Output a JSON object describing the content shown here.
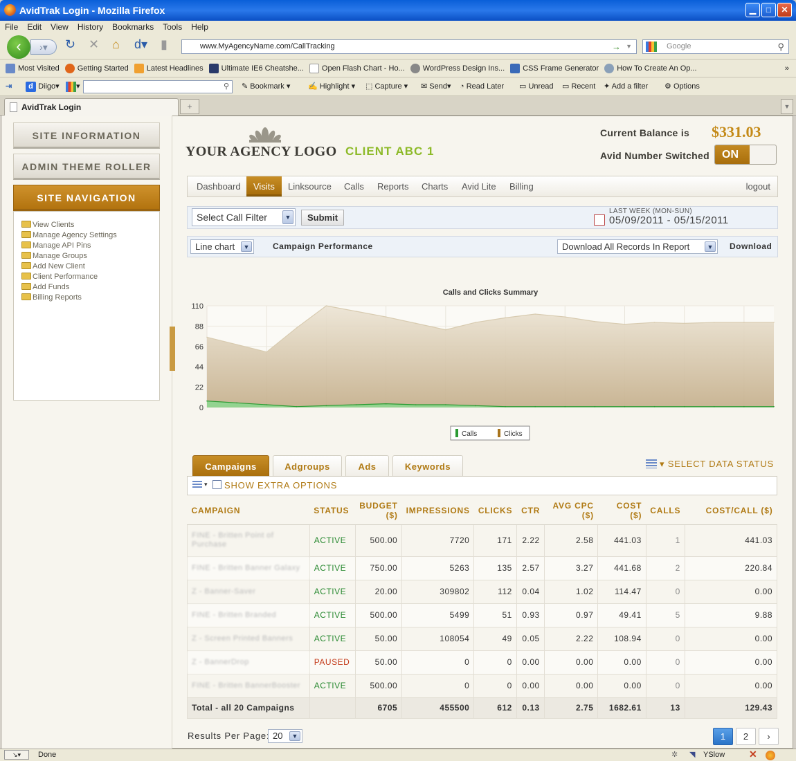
{
  "window": {
    "title": "AvidTrak Login - Mozilla Firefox"
  },
  "menu": [
    "File",
    "Edit",
    "View",
    "History",
    "Bookmarks",
    "Tools",
    "Help"
  ],
  "address": {
    "url": "www.MyAgencyName.com/CallTracking",
    "search_placeholder": "Google"
  },
  "bookmarks": [
    "Most Visited",
    "Getting Started",
    "Latest Headlines",
    "Ultimate IE6 Cheatshe...",
    "Open Flash Chart - Ho...",
    "WordPress Design Ins...",
    "CSS Frame Generator",
    "How To Create An Op..."
  ],
  "diigo": {
    "brand": "Diigo",
    "items": [
      "Bookmark",
      "Highlight",
      "Capture",
      "Send",
      "Read Later",
      "Unread",
      "Recent",
      "Add a filter",
      "Options"
    ]
  },
  "browser_tab": {
    "label": "AvidTrak Login"
  },
  "status_bar": {
    "text": "Done",
    "yslow": "YSlow"
  },
  "sidebar": {
    "site_information": "SITE INFORMATION",
    "admin_theme_roller": "ADMIN THEME ROLLER",
    "site_navigation": "SITE NAVIGATION",
    "links": [
      "View Clients",
      "Manage Agency Settings",
      "Manage API Pins",
      "Manage Groups",
      "Add New Client",
      "Client Performance",
      "Add Funds",
      "Billing Reports"
    ]
  },
  "header": {
    "logo_text": "YOUR AGENCY LOGO",
    "client_name": "CLIENT ABC 1",
    "balance_label": "Current Balance is",
    "balance_value": "$331.03",
    "switch_label": "Avid Number Switched",
    "switch_state": "ON"
  },
  "main_nav": {
    "tabs": [
      "Dashboard",
      "Visits",
      "Linksource",
      "Calls",
      "Reports",
      "Charts",
      "Avid Lite",
      "Billing"
    ],
    "active": "Visits",
    "logout": "logout"
  },
  "filter": {
    "select_label": "Select Call Filter",
    "submit": "Submit",
    "date_label": "LAST WEEK (MON-SUN)",
    "date_range": "05/09/2011 - 05/15/2011"
  },
  "chart_controls": {
    "chart_type": "Line chart",
    "title": "Campaign Performance",
    "download_select": "Download All Records In Report",
    "download": "Download"
  },
  "chart_data": {
    "type": "area",
    "title": "Calls and Clicks Summary",
    "x": [
      "1",
      "2",
      "3",
      "4",
      "5",
      "6",
      "7",
      "8",
      "9",
      "10",
      "11",
      "12",
      "13",
      "14",
      "15",
      "16",
      "17",
      "18",
      "19",
      "20"
    ],
    "series": [
      {
        "name": "Clicks",
        "color": "#a8741c",
        "values": [
          76,
          68,
          60,
          86,
          110,
          104,
          98,
          91,
          84,
          92,
          97,
          101,
          98,
          93,
          90,
          92,
          91,
          92,
          92,
          92
        ]
      },
      {
        "name": "Calls",
        "color": "#2a9a32",
        "values": [
          7,
          5,
          3,
          1,
          2,
          3,
          4,
          3,
          3,
          2,
          1,
          1,
          1,
          1,
          1,
          1,
          1,
          1,
          1,
          1
        ]
      }
    ],
    "ylim": [
      0,
      110
    ],
    "yticks": [
      0,
      22,
      44,
      66,
      88,
      110
    ],
    "grid": true,
    "legend": "bottom-center"
  },
  "data_tabs": [
    "Campaigns",
    "Adgroups",
    "Ads",
    "Keywords"
  ],
  "select_data_status": "SELECT DATA STATUS",
  "show_extra": "SHOW EXTRA OPTIONS",
  "table": {
    "headers": [
      "CAMPAIGN",
      "STATUS",
      "BUDGET ($)",
      "IMPRESSIONS",
      "CLICKS",
      "CTR",
      "AVG CPC ($)",
      "COST ($)",
      "CALLS",
      "COST/CALL ($)"
    ],
    "rows": [
      [
        "FINE - Britten Point of Purchase",
        "ACTIVE",
        "500.00",
        "7720",
        "171",
        "2.22",
        "2.58",
        "441.03",
        "1",
        "441.03"
      ],
      [
        "FINE - Britten Banner Galaxy",
        "ACTIVE",
        "750.00",
        "5263",
        "135",
        "2.57",
        "3.27",
        "441.68",
        "2",
        "220.84"
      ],
      [
        "Z - Banner-Saver",
        "ACTIVE",
        "20.00",
        "309802",
        "112",
        "0.04",
        "1.02",
        "114.47",
        "0",
        "0.00"
      ],
      [
        "FINE - Britten Branded",
        "ACTIVE",
        "500.00",
        "5499",
        "51",
        "0.93",
        "0.97",
        "49.41",
        "5",
        "9.88"
      ],
      [
        "Z - Screen Printed Banners",
        "ACTIVE",
        "50.00",
        "108054",
        "49",
        "0.05",
        "2.22",
        "108.94",
        "0",
        "0.00"
      ],
      [
        "Z - BannerDrop",
        "PAUSED",
        "50.00",
        "0",
        "0",
        "0.00",
        "0.00",
        "0.00",
        "0",
        "0.00"
      ],
      [
        "FINE - Britten BannerBooster",
        "ACTIVE",
        "500.00",
        "0",
        "0",
        "0.00",
        "0.00",
        "0.00",
        "0",
        "0.00"
      ]
    ],
    "total": [
      "Total - all 20 Campaigns",
      "",
      "6705",
      "455500",
      "612",
      "0.13",
      "2.75",
      "1682.61",
      "13",
      "129.43"
    ]
  },
  "footer": {
    "results_label": "Results Per Page:",
    "results_value": "20",
    "pages": [
      "1",
      "2"
    ],
    "next": "›"
  }
}
